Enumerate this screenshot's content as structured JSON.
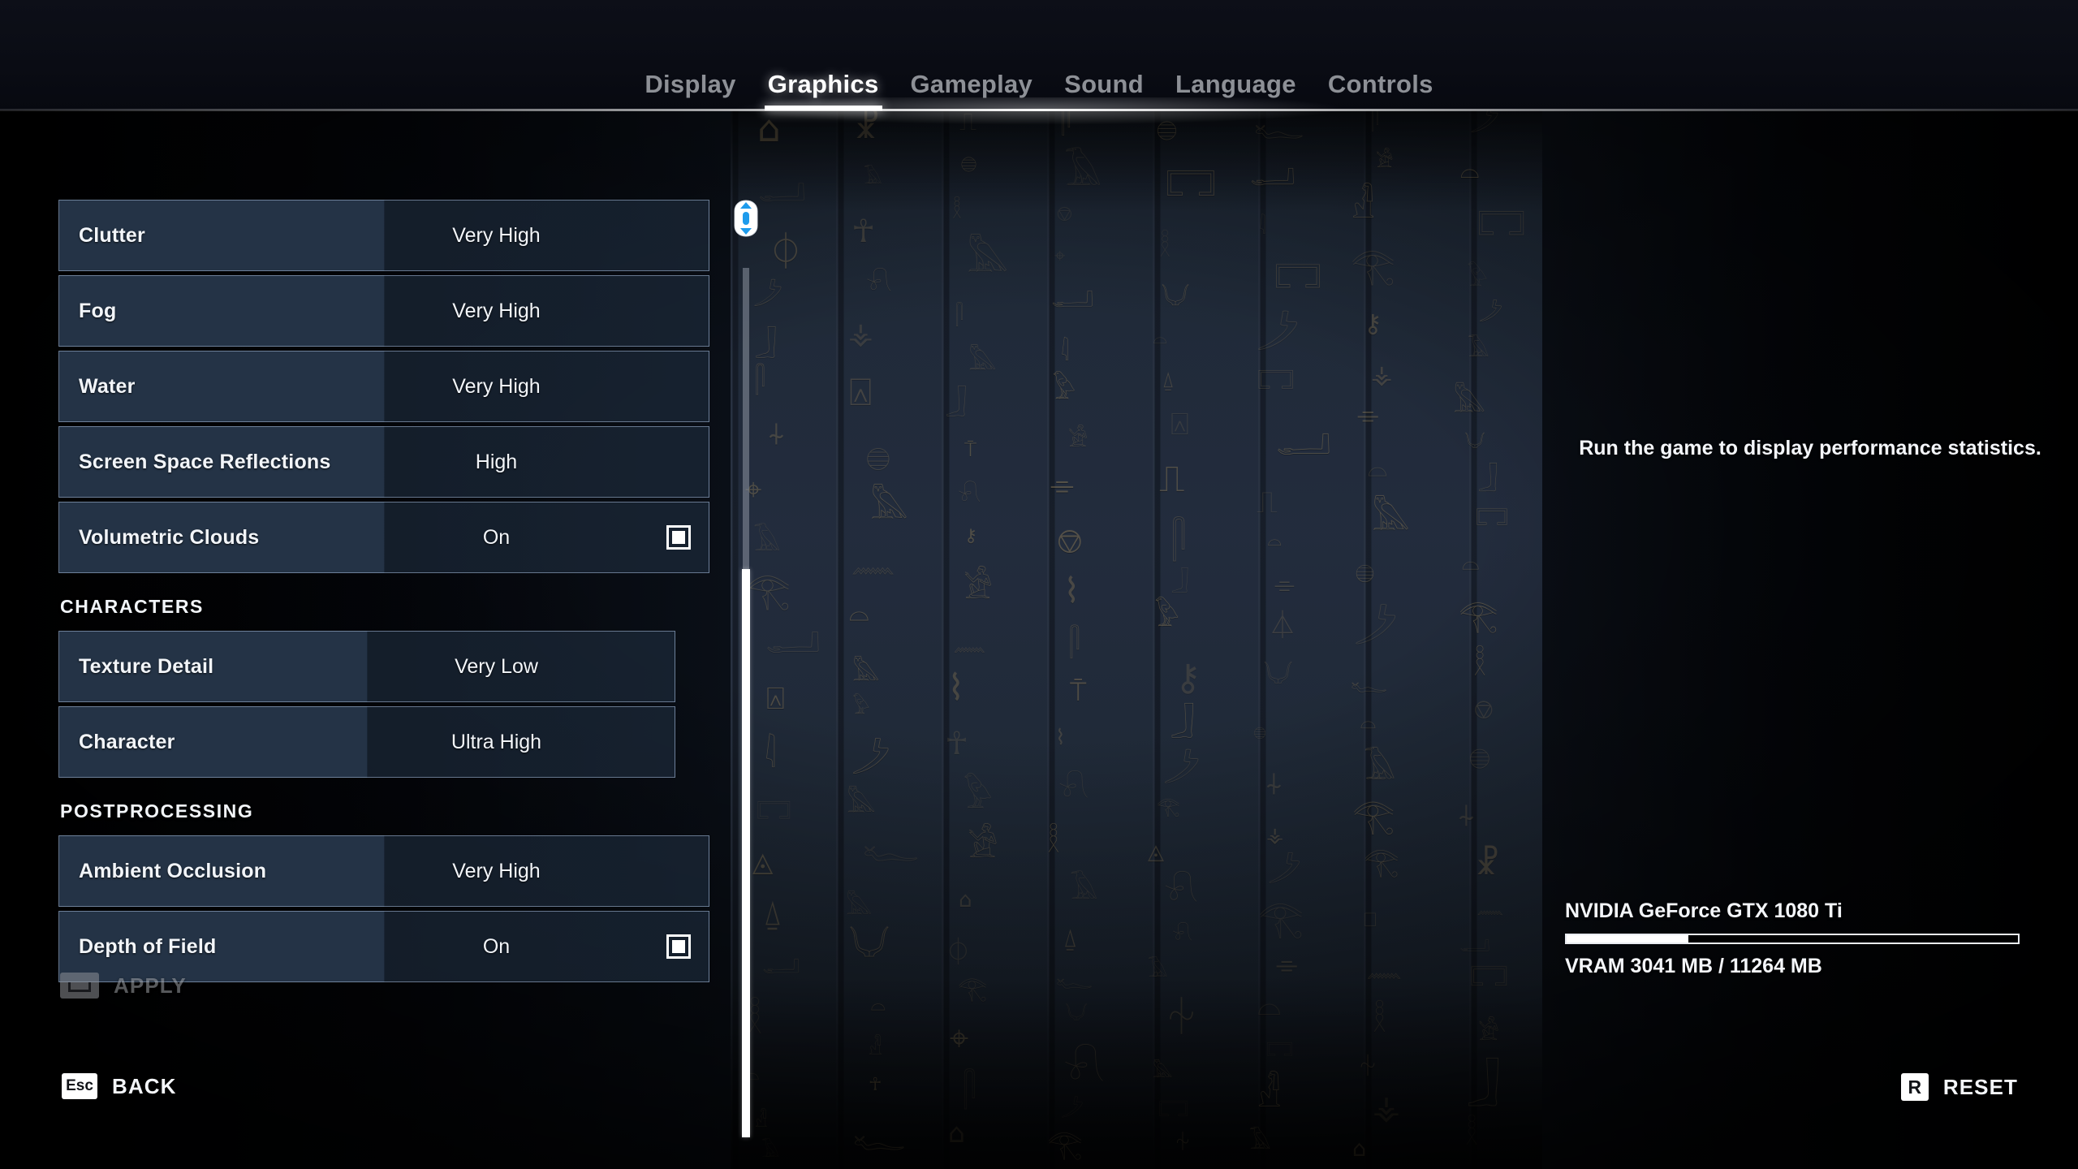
{
  "tabs": [
    {
      "label": "Display",
      "active": false
    },
    {
      "label": "Graphics",
      "active": true
    },
    {
      "label": "Gameplay",
      "active": false
    },
    {
      "label": "Sound",
      "active": false
    },
    {
      "label": "Language",
      "active": false
    },
    {
      "label": "Controls",
      "active": false
    }
  ],
  "settings": [
    {
      "label": "Clutter",
      "value": "Very High",
      "checkbox": false,
      "wide": true
    },
    {
      "label": "Fog",
      "value": "Very High",
      "checkbox": false,
      "wide": true
    },
    {
      "label": "Water",
      "value": "Very High",
      "checkbox": false,
      "wide": true
    },
    {
      "label": "Screen Space Reflections",
      "value": "High",
      "checkbox": false,
      "wide": true
    },
    {
      "label": "Volumetric Clouds",
      "value": "On",
      "checkbox": true,
      "wide": true
    }
  ],
  "sections": [
    {
      "header": "CHARACTERS",
      "rows": [
        {
          "label": "Texture Detail",
          "value": "Very Low",
          "checkbox": false,
          "wide": false
        },
        {
          "label": "Character",
          "value": "Ultra High",
          "checkbox": false,
          "wide": false
        }
      ]
    },
    {
      "header": "POSTPROCESSING",
      "rows": [
        {
          "label": "Ambient Occlusion",
          "value": "Very High",
          "checkbox": false,
          "wide": true
        },
        {
          "label": "Depth of Field",
          "value": "On",
          "checkbox": true,
          "wide": true
        }
      ]
    }
  ],
  "info": {
    "performance_message": "Run the game to display performance statistics.",
    "gpu_name": "NVIDIA GeForce GTX 1080 Ti",
    "vram_text": "VRAM 3041 MB / 11264 MB",
    "vram_used_mb": 3041,
    "vram_total_mb": 11264,
    "vram_fill_percent": 27
  },
  "buttons": {
    "apply": {
      "key": "",
      "label": "APPLY",
      "key_icon": "spacebar-key-icon",
      "enabled": false
    },
    "back": {
      "key": "Esc",
      "label": "BACK",
      "key_icon": "esc-key-icon",
      "enabled": true
    },
    "reset": {
      "key": "R",
      "label": "RESET",
      "key_icon": "r-key-icon",
      "enabled": true
    }
  },
  "scroll": {
    "hint_icon": "mouse-scroll-icon",
    "thumb_position_percent": 62
  },
  "colors": {
    "row_fill": "#26364a",
    "row_border": "#aac0de",
    "accent_white": "#ffffff",
    "mouse_blue": "#1e9bec",
    "background_wall": "#222d3e"
  }
}
